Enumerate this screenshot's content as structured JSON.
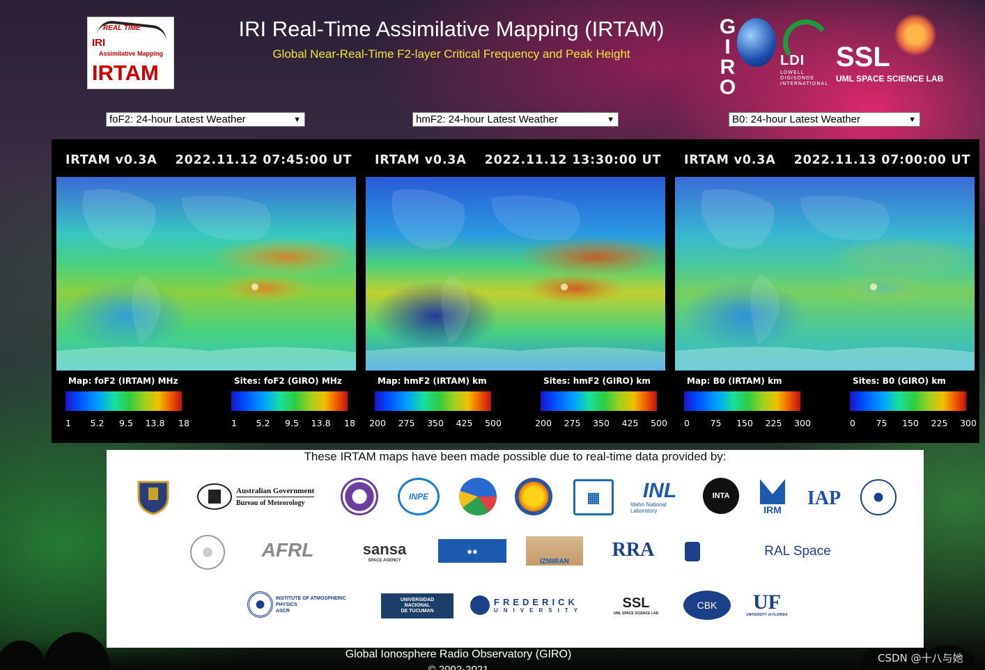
{
  "header": {
    "logo_real_time": "REAL TIME",
    "logo_iri": "IRI",
    "logo_assim": "Assimilative Mapping",
    "logo_irtam": "IRTAM",
    "title": "IRI Real-Time Assimilative Mapping (IRTAM)",
    "subtitle": "Global Near-Real-Time F2-layer Critical Frequency and Peak Height",
    "giro_logo_text": "GIRO",
    "ldi_text": "LDI",
    "ldi_sub": "LOWELL DIGISONDE INTERNATIONAL",
    "ssl_text": "SSL",
    "ssl_sub": "UML SPACE SCIENCE LAB"
  },
  "selects": [
    {
      "value": "foF2: 24-hour Latest Weather"
    },
    {
      "value": "hmF2: 24-hour Latest Weather"
    },
    {
      "value": "B0: 24-hour Latest Weather"
    }
  ],
  "maps": [
    {
      "version": "IRTAM v0.3A",
      "timestamp": "2022.11.12 07:45:00 UT",
      "map_label": "Map: foF2 (IRTAM) MHz",
      "sites_label": "Sites: foF2 (GIRO) MHz",
      "ticks": [
        "1",
        "5.2",
        "9.5",
        "13.8",
        "18"
      ],
      "palette": "fof2"
    },
    {
      "version": "IRTAM v0.3A",
      "timestamp": "2022.11.12 13:30:00 UT",
      "map_label": "Map: hmF2 (IRTAM) km",
      "sites_label": "Sites: hmF2 (GIRO) km",
      "ticks": [
        "200",
        "275",
        "350",
        "425",
        "500"
      ],
      "palette": "hmf2"
    },
    {
      "version": "IRTAM v0.3A",
      "timestamp": "2022.11.13 07:00:00 UT",
      "map_label": "Map: B0 (IRTAM) km",
      "sites_label": "Sites: B0 (GIRO) km",
      "ticks": [
        "0",
        "75",
        "150",
        "225",
        "300"
      ],
      "palette": "b0"
    }
  ],
  "logos_panel": {
    "intro": "These IRTAM maps have been made possible due to real-time data provided by:",
    "orgs": {
      "afws": "AFWA",
      "bom_line1": "Australian Government",
      "bom_line2": "Bureau of Meteorology",
      "inpe": "INPE",
      "inl": "INL",
      "inl_sub": "Idaho National Laboratory",
      "inta": "INTA",
      "irm": "IRM",
      "iap": "IAP",
      "afrl": "AFRL",
      "sansa": "sansa",
      "sansa_sub": "SPACE AGENCY",
      "izmiran": "IZMIRAN",
      "rra": "RRA",
      "ral": "RAL Space",
      "iap_ascr": "INSTITUTE OF ATMOSPHERIC PHYSICS",
      "iap_ascr_sub": "ASCR",
      "unt_line1": "UNIVERSIDAD",
      "unt_line2": "NACIONAL",
      "unt_line3": "DE TUCUMAN",
      "frederick_line1": "FREDERICK",
      "frederick_line2": "UNIVERSITY",
      "ssl_small": "SSL",
      "ssl_small_sub": "UML SPACE SCIENCE LAB",
      "cbk": "CBK",
      "uf": "UF",
      "uf_sub": "UNIVERSITY of FLORIDA"
    }
  },
  "footer": {
    "line1": "Global Ionosphere Radio Observatory (GIRO)",
    "line2": "© 2002-2021"
  },
  "watermark": "CSDN @十八与她"
}
